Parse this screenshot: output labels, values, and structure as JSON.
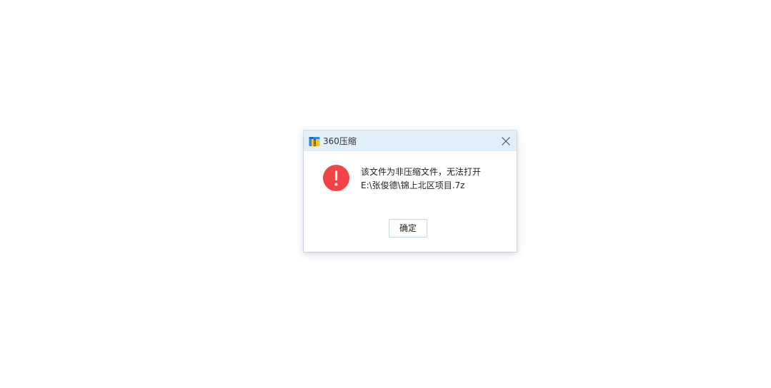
{
  "dialog": {
    "title": "360压缩",
    "app_icon": "360-zip-archive-icon",
    "close_icon": "close-icon",
    "message": {
      "icon": "error-exclamation-icon",
      "line1": "该文件为非压缩文件，无法打开",
      "line2": "E:\\张俊德\\锦上北区项目.7z"
    },
    "ok_label": "确定"
  },
  "colors": {
    "titlebar_bg": "#e2eef9",
    "error_red": "#f24444",
    "button_border": "#c6d7e8"
  }
}
